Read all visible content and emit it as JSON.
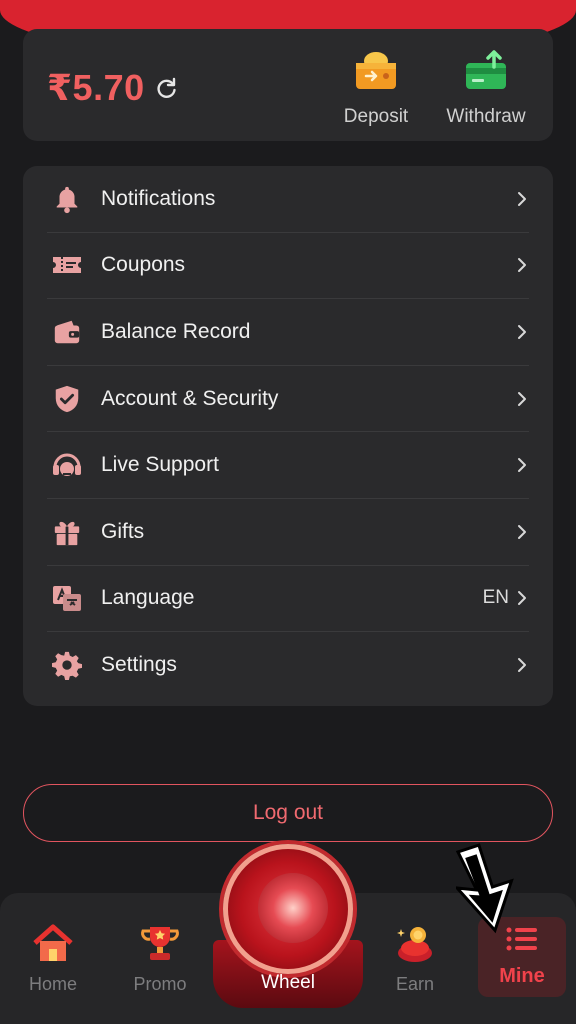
{
  "wallet": {
    "balance": "₹5.70",
    "deposit_label": "Deposit",
    "withdraw_label": "Withdraw"
  },
  "menu": {
    "items": [
      {
        "label": "Notifications",
        "icon": "bell-icon"
      },
      {
        "label": "Coupons",
        "icon": "ticket-icon"
      },
      {
        "label": "Balance Record",
        "icon": "wallet-icon"
      },
      {
        "label": "Account & Security",
        "icon": "shield-check-icon"
      },
      {
        "label": "Live Support",
        "icon": "headset-icon"
      },
      {
        "label": "Gifts",
        "icon": "gift-icon"
      },
      {
        "label": "Language",
        "icon": "translate-icon",
        "value": "EN"
      },
      {
        "label": "Settings",
        "icon": "gear-icon"
      }
    ]
  },
  "logout_label": "Log out",
  "tabs": {
    "home": "Home",
    "promo": "Promo",
    "wheel": "Wheel",
    "earn": "Earn",
    "mine": "Mine"
  },
  "colors": {
    "accent": "#f0424b",
    "background": "#1b1b1d",
    "card": "#2a2a2c",
    "icon": "#e8a2a2"
  }
}
